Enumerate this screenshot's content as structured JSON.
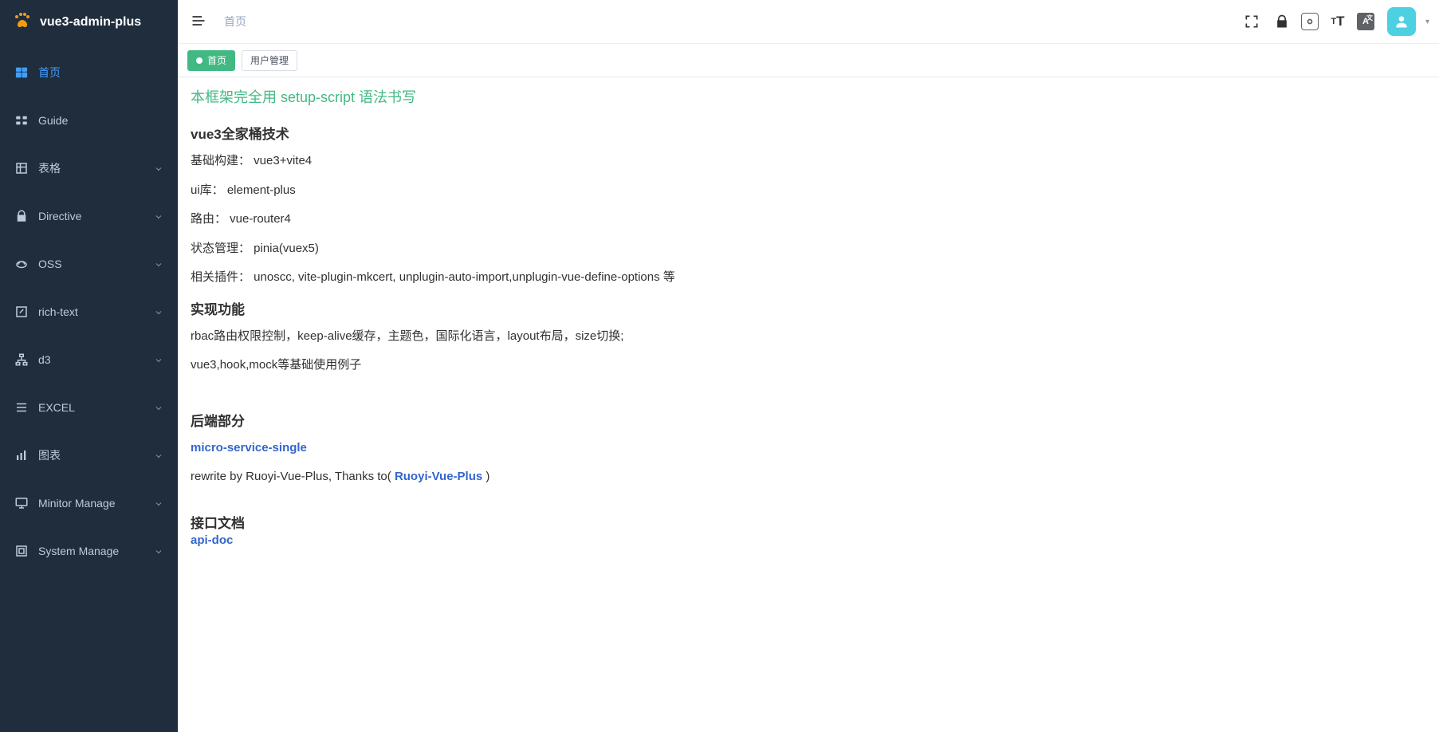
{
  "app": {
    "title": "vue3-admin-plus"
  },
  "sidebar": {
    "items": [
      {
        "label": "首页",
        "icon": "home",
        "active": true,
        "expandable": false
      },
      {
        "label": "Guide",
        "icon": "guide",
        "active": false,
        "expandable": false
      },
      {
        "label": "表格",
        "icon": "table",
        "active": false,
        "expandable": true
      },
      {
        "label": "Directive",
        "icon": "lock",
        "active": false,
        "expandable": true
      },
      {
        "label": "OSS",
        "icon": "cloud",
        "active": false,
        "expandable": true
      },
      {
        "label": "rich-text",
        "icon": "edit",
        "active": false,
        "expandable": true
      },
      {
        "label": "d3",
        "icon": "tree",
        "active": false,
        "expandable": true
      },
      {
        "label": "EXCEL",
        "icon": "list",
        "active": false,
        "expandable": true
      },
      {
        "label": "图表",
        "icon": "chart",
        "active": false,
        "expandable": true
      },
      {
        "label": "Minitor Manage",
        "icon": "monitor",
        "active": false,
        "expandable": true
      },
      {
        "label": "System Manage",
        "icon": "system",
        "active": false,
        "expandable": true
      }
    ]
  },
  "navbar": {
    "breadcrumb": "首页",
    "icons": [
      "fullscreen",
      "lock",
      "screenshot",
      "textsize",
      "lang"
    ]
  },
  "tags": [
    {
      "label": "首页",
      "active": true
    },
    {
      "label": "用户管理",
      "active": false
    }
  ],
  "content": {
    "green_heading": "本框架完全用 setup-script 语法书写",
    "tech_heading": "vue3全家桶技术",
    "line_build": "基础构建： vue3+vite4",
    "line_ui": "ui库：  element-plus",
    "line_router": "路由：  vue-router4",
    "line_state": "状态管理：  pinia(vuex5)",
    "line_plugin": "相关插件：  unoscc, vite-plugin-mkcert, unplugin-auto-import,unplugin-vue-define-options 等",
    "feature_heading": "实现功能",
    "line_feat1": "rbac路由权限控制，keep-alive缓存，主题色，国际化语言，layout布局，size切换;",
    "line_feat2": "vue3,hook,mock等基础使用例子",
    "backend_heading": "后端部分",
    "link_micro": "micro-service-single",
    "rewrite_prefix": "rewrite by Ruoyi-Vue-Plus, Thanks to( ",
    "link_ruoyi": "Ruoyi-Vue-Plus",
    "rewrite_suffix": " )",
    "api_heading": "接口文档",
    "link_api": "api-doc"
  }
}
